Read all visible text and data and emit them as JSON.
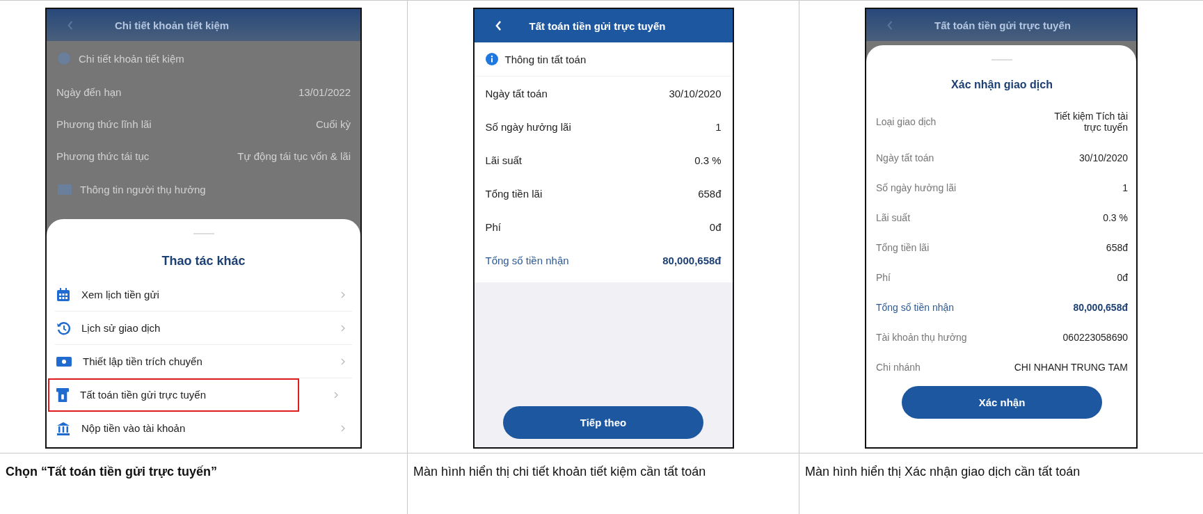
{
  "screens": [
    {
      "kind": "action_sheet",
      "background": {
        "title": "Chi tiết khoản tiết kiệm",
        "section": "Chi tiết khoản tiết kiệm",
        "rows": [
          {
            "label": "Ngày đến hạn",
            "value": "13/01/2022"
          },
          {
            "label": "Phương thức lĩnh lãi",
            "value": "Cuối kỳ"
          },
          {
            "label": "Phương thức tái tục",
            "value": "Tự động tái tục vốn & lãi"
          }
        ],
        "section_2": "Thông tin người thụ hưởng"
      },
      "sheet": {
        "title": "Thao tác khác",
        "items": [
          {
            "label": "Xem lịch tiền gửi",
            "highlighted": false
          },
          {
            "label": "Lịch sử giao dịch",
            "highlighted": false
          },
          {
            "label": "Thiết lập tiền trích chuyển",
            "highlighted": false
          },
          {
            "label": "Tất toán tiền gửi trực tuyến",
            "highlighted": true
          },
          {
            "label": "Nộp tiền vào tài khoản",
            "highlighted": false
          }
        ]
      }
    },
    {
      "kind": "detail",
      "title": "Tất toán tiền gửi trực tuyến",
      "section": "Thông tin tất toán",
      "rows": [
        {
          "label": "Ngày tất toán",
          "value": "30/10/2020",
          "emphasized": false
        },
        {
          "label": "Số ngày hưởng lãi",
          "value": "1",
          "emphasized": false
        },
        {
          "label": "Lãi suất",
          "value": "0.3 %",
          "emphasized": false
        },
        {
          "label": "Tổng tiền lãi",
          "value": "658đ",
          "emphasized": false
        },
        {
          "label": "Phí",
          "value": "0đ",
          "emphasized": false
        },
        {
          "label": "Tổng số tiền nhận",
          "value": "80,000,658đ",
          "emphasized": true
        }
      ],
      "button": "Tiếp theo"
    },
    {
      "kind": "confirm",
      "background_title": "Tất toán tiền gửi trực tuyến",
      "sheet": {
        "title": "Xác nhận giao dịch",
        "rows": [
          {
            "label": "Loại giao dịch",
            "value": "Tiết kiệm Tích tài trực tuyến",
            "emphasized": false
          },
          {
            "label": "Ngày tất toán",
            "value": "30/10/2020",
            "emphasized": false
          },
          {
            "label": "Số ngày hưởng lãi",
            "value": "1",
            "emphasized": false
          },
          {
            "label": "Lãi suất",
            "value": "0.3 %",
            "emphasized": false
          },
          {
            "label": "Tổng tiền lãi",
            "value": "658đ",
            "emphasized": false
          },
          {
            "label": "Phí",
            "value": "0đ",
            "emphasized": false
          },
          {
            "label": "Tổng số tiền nhận",
            "value": "80,000,658đ",
            "emphasized": true
          },
          {
            "label": "Tài khoản thụ hưởng",
            "value": "060223058690",
            "emphasized": false
          },
          {
            "label": "Chi nhánh",
            "value": "CHI NHANH TRUNG TAM",
            "emphasized": false
          }
        ],
        "button": "Xác nhận"
      }
    }
  ],
  "captions": [
    {
      "text": "Chọn “Tất toán tiền gửi trực tuyến”",
      "bold": true
    },
    {
      "text": "Màn hình hiển thị chi tiết khoản tiết kiệm cần tất toán",
      "bold": false
    },
    {
      "text": "Màn hình hiển thị Xác nhận giao dịch cần tất toán",
      "bold": false
    }
  ]
}
